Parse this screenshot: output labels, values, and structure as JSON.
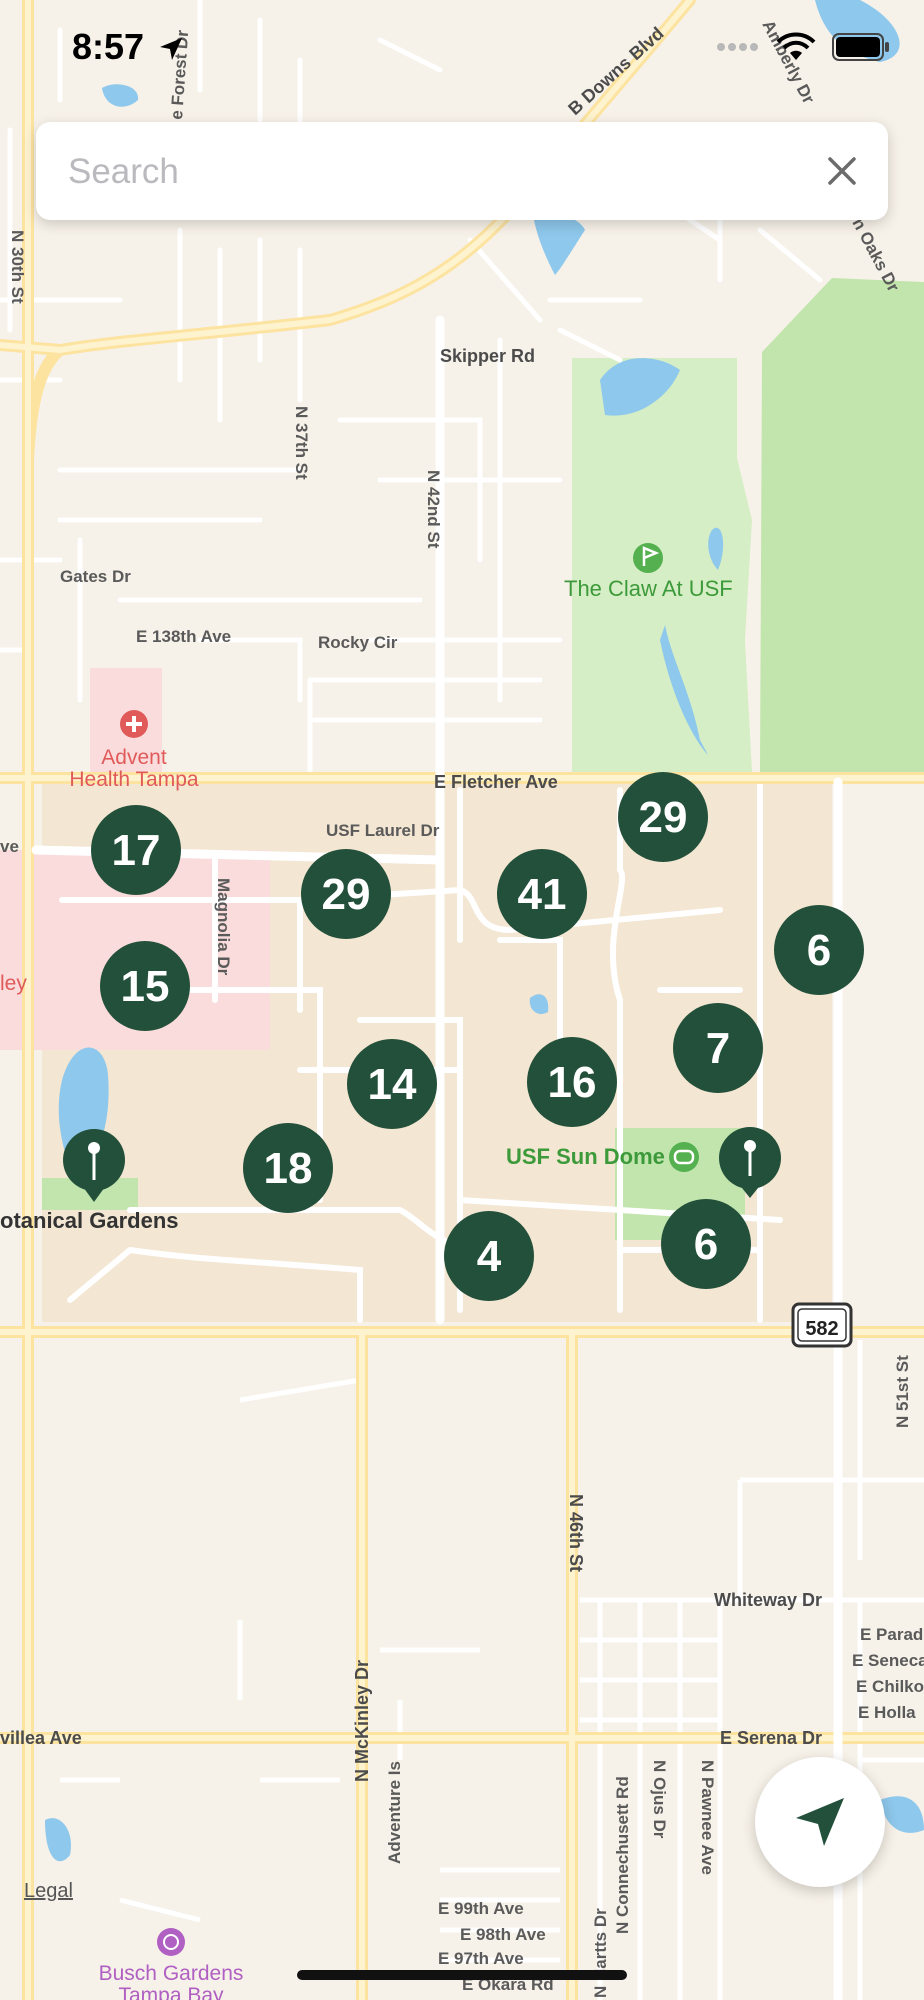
{
  "status_bar": {
    "time": "8:57"
  },
  "search": {
    "placeholder": "Search",
    "value": ""
  },
  "map": {
    "clusters": [
      {
        "count": "29"
      },
      {
        "count": "17"
      },
      {
        "count": "29"
      },
      {
        "count": "41"
      },
      {
        "count": "6"
      },
      {
        "count": "15"
      },
      {
        "count": "7"
      },
      {
        "count": "14"
      },
      {
        "count": "16"
      },
      {
        "count": "18"
      },
      {
        "count": "6"
      },
      {
        "count": "4"
      }
    ],
    "places": {
      "claw": "The Claw At USF",
      "advent1": "Advent",
      "advent2": "Health Tampa",
      "sundome": "USF Sun Dome",
      "botanical": "otanical Gardens",
      "busch1": "Busch Gardens",
      "busch2": "Tampa Bay",
      "ley": "ley"
    },
    "roads": {
      "downs": "B Downs Blvd",
      "forest": "e Forest Dr",
      "amberly": "Amberly Dr",
      "oaks": "n Oaks Dr",
      "n30": "N 30th St",
      "skipper": "Skipper Rd",
      "n37": "N 37th St",
      "n42": "N 42nd St",
      "gates": "Gates Dr",
      "e138": "E 138th Ave",
      "rocky": "Rocky Cir",
      "fletcher": "E Fletcher Ave",
      "laurel": "USF Laurel Dr",
      "magnolia": "Magnolia Dr",
      "ave": "ve",
      "n46": "N 46th St",
      "whiteway": "Whiteway Dr",
      "mckinley": "N McKinley Dr",
      "villea": "villea Ave",
      "serena": "E Serena Dr",
      "adventure": "Adventure Is",
      "connechusett": "N Connechusett Rd",
      "ojus": "N Ojus Dr",
      "pawnee": "N Pawnee Ave",
      "hartts": "N Hartts Dr",
      "e99": "E 99th Ave",
      "e98": "E 98th Ave",
      "e97": "E 97th Ave",
      "okara": "E Okara Rd",
      "n51": "N 51st St",
      "parad": "E Parad",
      "seneca": "E Seneca",
      "chilko": "E Chilko",
      "holla": "E Holla",
      "hwy": "582"
    }
  },
  "legal": "Legal",
  "colors": {
    "cluster": "#23503a",
    "park": "#c1e5ad",
    "park_light": "#d6eec5",
    "water": "#8ec8ec",
    "campus": "#f3e6d2",
    "hospital": "#fadcdc",
    "road_major": "#fde9b6",
    "place_green": "#3d9a3a",
    "place_red": "#e05a5a",
    "place_purple": "#b05fc2"
  }
}
